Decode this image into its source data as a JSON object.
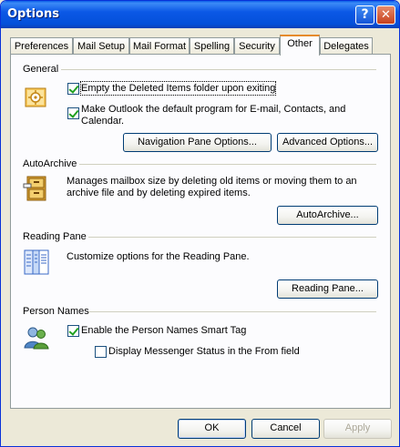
{
  "window": {
    "title": "Options"
  },
  "titlebar_buttons": {
    "help": "?",
    "close": "✕"
  },
  "tabs": [
    {
      "label": "Preferences"
    },
    {
      "label": "Mail Setup"
    },
    {
      "label": "Mail Format"
    },
    {
      "label": "Spelling"
    },
    {
      "label": "Security"
    },
    {
      "label": "Other",
      "active": true
    },
    {
      "label": "Delegates"
    }
  ],
  "general": {
    "title": "General",
    "empty_deleted": {
      "label": "Empty the Deleted Items folder upon exiting",
      "checked": true
    },
    "default_program": {
      "label_line1": "Make Outlook the default program for E-mail, Contacts, and",
      "label_line2": "Calendar.",
      "checked": true
    },
    "nav_pane_button": "Navigation Pane Options...",
    "advanced_button": "Advanced Options..."
  },
  "autoarchive": {
    "title": "AutoArchive",
    "description_line1": "Manages mailbox size by deleting old items or moving them to an",
    "description_line2": "archive file and by deleting expired items.",
    "button": "AutoArchive..."
  },
  "reading_pane": {
    "title": "Reading Pane",
    "description": "Customize options for the Reading Pane.",
    "button": "Reading Pane..."
  },
  "person_names": {
    "title": "Person Names",
    "smart_tag": {
      "label": "Enable the Person Names Smart Tag",
      "checked": true
    },
    "messenger_status": {
      "label": "Display Messenger Status in the From field",
      "checked": false
    }
  },
  "footer": {
    "ok": "OK",
    "cancel": "Cancel",
    "apply": "Apply"
  },
  "icons": {
    "general": "options-gear-icon",
    "autoarchive": "archive-cabinet-icon",
    "reading_pane": "reading-pane-icon",
    "person_names": "person-names-icon"
  },
  "colors": {
    "titlebar": "#0450d9",
    "dialog_bg": "#ece9d8",
    "panel_bg": "#fcfcfe",
    "active_tab_accent": "#e68b2c"
  }
}
